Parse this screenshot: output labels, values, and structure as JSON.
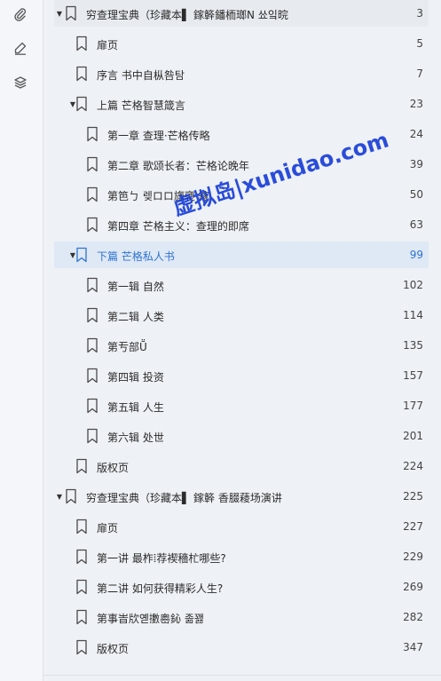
{
  "rail": {
    "icons": [
      "paperclip-icon",
      "pen-icon",
      "layers-icon"
    ]
  },
  "outline": [
    {
      "label": "穷查理宝典（珍藏本▌ 鎵簳鐇栭瑯N  쑈잌晥",
      "page": "3",
      "level": 0,
      "expanded": true
    },
    {
      "label": "扉页",
      "page": "5",
      "level": 1
    },
    {
      "label": "序言 书中自枞咎탐",
      "page": "7",
      "level": 1
    },
    {
      "label": "上篇 芒格智慧箴言",
      "page": "23",
      "level": 1,
      "expanded": true
    },
    {
      "label": "第一章 查理·芒格传略",
      "page": "24",
      "level": 2
    },
    {
      "label": "第二章 歌颂长者：芒格论晚年",
      "page": "39",
      "level": 2
    },
    {
      "label": "第笆ㄅ 렞ロロ旚褏  鎵",
      "page": "50",
      "level": 2
    },
    {
      "label": "第四章 芒格主义：查理的即席",
      "page": "63",
      "level": 2
    },
    {
      "label": "下篇 芒格私人书",
      "page": "99",
      "level": 1,
      "expanded": true,
      "selected": true
    },
    {
      "label": "第一辑 自然",
      "page": "102",
      "level": 2
    },
    {
      "label": "第二辑 人类",
      "page": "114",
      "level": 2
    },
    {
      "label": "第亐部Ṻ",
      "page": "135",
      "level": 2
    },
    {
      "label": "第四辑 投资",
      "page": "157",
      "level": 2
    },
    {
      "label": "第五辑 人生",
      "page": "177",
      "level": 2
    },
    {
      "label": "第六辑 处世",
      "page": "201",
      "level": 2
    },
    {
      "label": "版权页",
      "page": "224",
      "level": 1
    },
    {
      "label": "穷查理宝典（珍藏本▌ 鎵簳  香腏薐场演讲",
      "page": "225",
      "level": 0,
      "expanded": true
    },
    {
      "label": "扉页",
      "page": "227",
      "level": 1
    },
    {
      "label": "第一讲 最柞ⵂ荐褉穡杧哪些?",
      "page": "229",
      "level": 1
    },
    {
      "label": "第二讲 如何获得精彩人生?",
      "page": "269",
      "level": 1
    },
    {
      "label": "第事旹㸝옏擻嶴鈊  졺꽳",
      "page": "282",
      "level": 1
    },
    {
      "label": "版权页",
      "page": "347",
      "level": 1
    }
  ],
  "watermark": "虚拟岛|xunidao.com",
  "colors": {
    "accent": "#2f74d0",
    "watermark": "#1a3fd8"
  }
}
